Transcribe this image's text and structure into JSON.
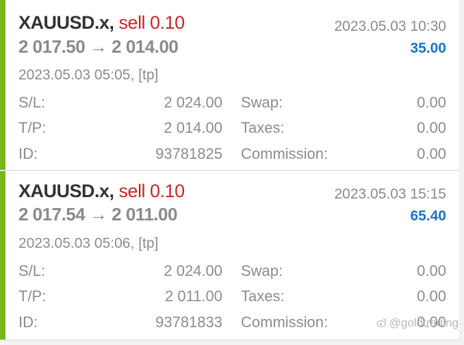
{
  "trades": [
    {
      "symbol": "XAUUSD.x,",
      "side": "sell 0.10",
      "prices": "2 017.50 → 2 014.00",
      "close_time": "2023.05.03 10:30",
      "profit": "35.00",
      "open_info": "2023.05.03 05:05, [tp]",
      "sl_label": "S/L:",
      "sl_value": "2 024.00",
      "tp_label": "T/P:",
      "tp_value": "2 014.00",
      "id_label": "ID:",
      "id_value": "93781825",
      "swap_label": "Swap:",
      "swap_value": "0.00",
      "taxes_label": "Taxes:",
      "taxes_value": "0.00",
      "commission_label": "Commission:",
      "commission_value": "0.00"
    },
    {
      "symbol": "XAUUSD.x,",
      "side": "sell 0.10",
      "prices": "2 017.54 → 2 011.00",
      "close_time": "2023.05.03 15:15",
      "profit": "65.40",
      "open_info": "2023.05.03 05:06, [tp]",
      "sl_label": "S/L:",
      "sl_value": "2 024.00",
      "tp_label": "T/P:",
      "tp_value": "2 011.00",
      "id_label": "ID:",
      "id_value": "93781833",
      "swap_label": "Swap:",
      "swap_value": "0.00",
      "taxes_label": "Taxes:",
      "taxes_value": "0.00",
      "commission_label": "Commission:",
      "commission_value": "0.00"
    }
  ],
  "watermark": {
    "text": "@goldtrading",
    "icon": "weibo-icon"
  },
  "colors": {
    "accent_bar": "#7cb518",
    "sell": "#c62828",
    "profit": "#1a73c8"
  }
}
